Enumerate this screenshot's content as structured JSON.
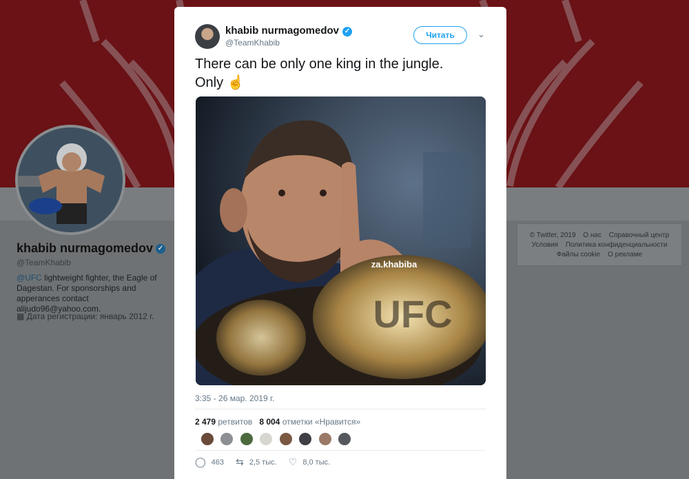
{
  "profile": {
    "name": "khabib nurmagomedov",
    "handle": "@TeamKhabib",
    "bio_link": "@UFC",
    "bio_text": " lightweight fighter, the Eagle of Dagestan. For sponsorships and apperances contact alijudo96@yahoo.com.",
    "joined": "Дата регистрации: январь 2012 г."
  },
  "footer": {
    "line1": [
      "© Twitter, 2019",
      "О нас",
      "Справочный центр"
    ],
    "line2": [
      "Условия",
      "Политика конфиденциальности"
    ],
    "line3": [
      "Файлы cookie",
      "О рекламе"
    ]
  },
  "tweet": {
    "author_name": "khabib nurmagomedov",
    "author_handle": "@TeamKhabib",
    "follow_label": "Читать",
    "text_line1": "There can be only one king in the jungle.",
    "text_line2": "Only",
    "emoji": "☝",
    "image_watermark": "za.khabiba",
    "timestamp": "3:35 - 26 мар. 2019 г.",
    "retweets_count": "2 479",
    "retweets_label": "ретвитов",
    "likes_count": "8 004",
    "likes_label": "отметки «Нравится»",
    "replies": "463",
    "retweets_short": "2,5 тыс.",
    "likes_short": "8,0 тыс."
  },
  "icons": {
    "reply": "reply-icon",
    "retweet": "retweet-icon",
    "like": "heart-icon",
    "verified": "verified-badge-icon",
    "calendar": "calendar-icon",
    "caret": "chevron-down-icon"
  },
  "colors": {
    "accent": "#1da1f2",
    "banner": "#6a1216",
    "overlay_bg": "#6f7274"
  }
}
